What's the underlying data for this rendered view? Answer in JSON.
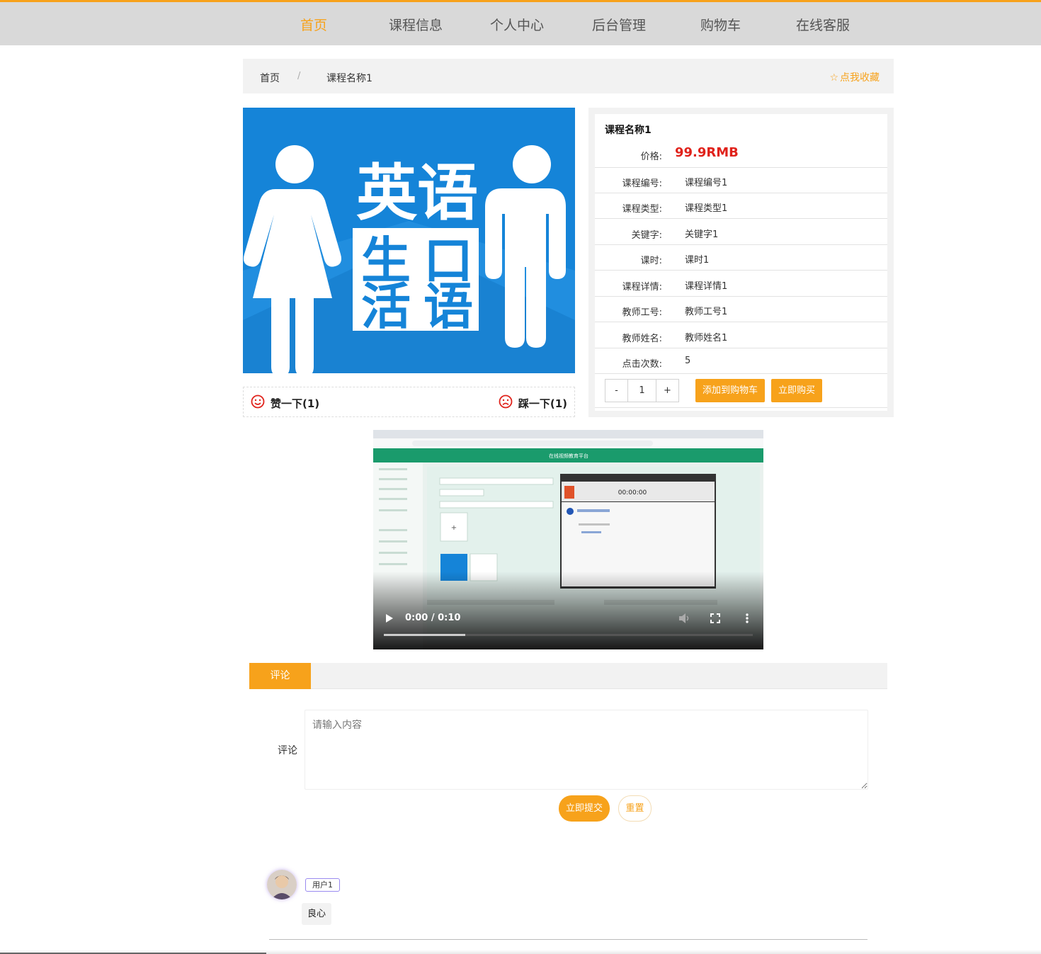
{
  "nav": {
    "items": [
      {
        "label": "首页",
        "active": true
      },
      {
        "label": "课程信息",
        "active": false
      },
      {
        "label": "个人中心",
        "active": false
      },
      {
        "label": "后台管理",
        "active": false
      },
      {
        "label": "购物车",
        "active": false
      },
      {
        "label": "在线客服",
        "active": false
      }
    ]
  },
  "breadcrumb": {
    "home": "首页",
    "separator": "/",
    "current": "课程名称1",
    "favorite": "点我收藏"
  },
  "cover": {
    "title_line1": "英语",
    "title_line2a": "生",
    "title_line2b": "口",
    "title_line3a": "活",
    "title_line3b": "语"
  },
  "likes": {
    "like_label": "赞一下(1)",
    "dislike_label": "踩一下(1)"
  },
  "course": {
    "name": "课程名称1",
    "price_label": "价格:",
    "price": "99.9RMB",
    "fields": [
      {
        "label": "课程编号:",
        "value": "课程编号1"
      },
      {
        "label": "课程类型:",
        "value": "课程类型1"
      },
      {
        "label": "关键字:",
        "value": "关键字1"
      },
      {
        "label": "课时:",
        "value": "课时1"
      },
      {
        "label": "课程详情:",
        "value": "课程详情1"
      },
      {
        "label": "教师工号:",
        "value": "教师工号1"
      },
      {
        "label": "教师姓名:",
        "value": "教师姓名1"
      },
      {
        "label": "点击次数:",
        "value": "5"
      }
    ],
    "quantity": {
      "minus": "-",
      "value": "1",
      "plus": "+"
    },
    "add_to_cart": "添加到购物车",
    "buy_now": "立即购买"
  },
  "video": {
    "time": "0:00 / 0:10",
    "progress_fraction": 0.22,
    "inner_header": "在线视频教育平台",
    "inner_clock": "00:00:00"
  },
  "comments": {
    "tab_label": "评论",
    "field_label": "评论",
    "placeholder": "请输入内容",
    "submit": "立即提交",
    "reset": "重置",
    "list": [
      {
        "user": "用户1",
        "content": "良心"
      }
    ]
  },
  "colors": {
    "accent": "#f7a21b",
    "price": "#e0221b",
    "cover_blue": "#1584d8",
    "nav_bg": "#d9d9d9"
  }
}
